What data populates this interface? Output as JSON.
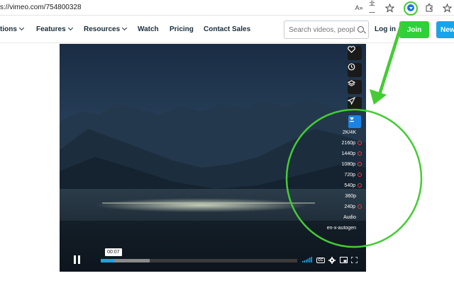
{
  "browser": {
    "url": "s://vimeo.com/754800328",
    "toolbar_icons": [
      "read-aloud-icon",
      "immersive-reader-icon",
      "add-favorite-icon",
      "extension-download-icon",
      "extensions-icon",
      "favorites-icon"
    ],
    "read_aloud_glyph": "A»",
    "reader_glyph": "㐀一"
  },
  "nav": {
    "items": [
      {
        "label": "tions",
        "has_menu": true
      },
      {
        "label": "Features",
        "has_menu": true
      },
      {
        "label": "Resources",
        "has_menu": true
      },
      {
        "label": "Watch",
        "has_menu": false
      },
      {
        "label": "Pricing",
        "has_menu": false
      },
      {
        "label": "Contact Sales",
        "has_menu": false
      }
    ],
    "search_placeholder": "Search videos, peopl",
    "login_label": "Log in",
    "join_label": "Join",
    "new_label": "New"
  },
  "player": {
    "side_buttons": [
      "heart-icon",
      "clock-icon",
      "layers-icon",
      "send-icon"
    ],
    "quality_menu": [
      {
        "label": "2K/4K",
        "marked": false
      },
      {
        "label": "2160p",
        "marked": true
      },
      {
        "label": "1440p",
        "marked": true
      },
      {
        "label": "1080p",
        "marked": true
      },
      {
        "label": "720p",
        "marked": true
      },
      {
        "label": "540p",
        "marked": true
      },
      {
        "label": "360p",
        "marked": false
      },
      {
        "label": "240p",
        "marked": true
      },
      {
        "label": "Audio",
        "marked": false
      },
      {
        "label": "en-x-autogen",
        "marked": false
      }
    ],
    "current_time": "00:07",
    "progress_played": 0.07,
    "progress_buffered": 0.25,
    "control_icons": [
      "volume-icon",
      "cc-icon",
      "settings-icon",
      "pip-icon",
      "fullscreen-icon"
    ],
    "cc_label": "CC"
  },
  "colors": {
    "accent_blue": "#17a4e8",
    "join_green": "#2ed13a",
    "annotation_green": "#44cc33"
  }
}
